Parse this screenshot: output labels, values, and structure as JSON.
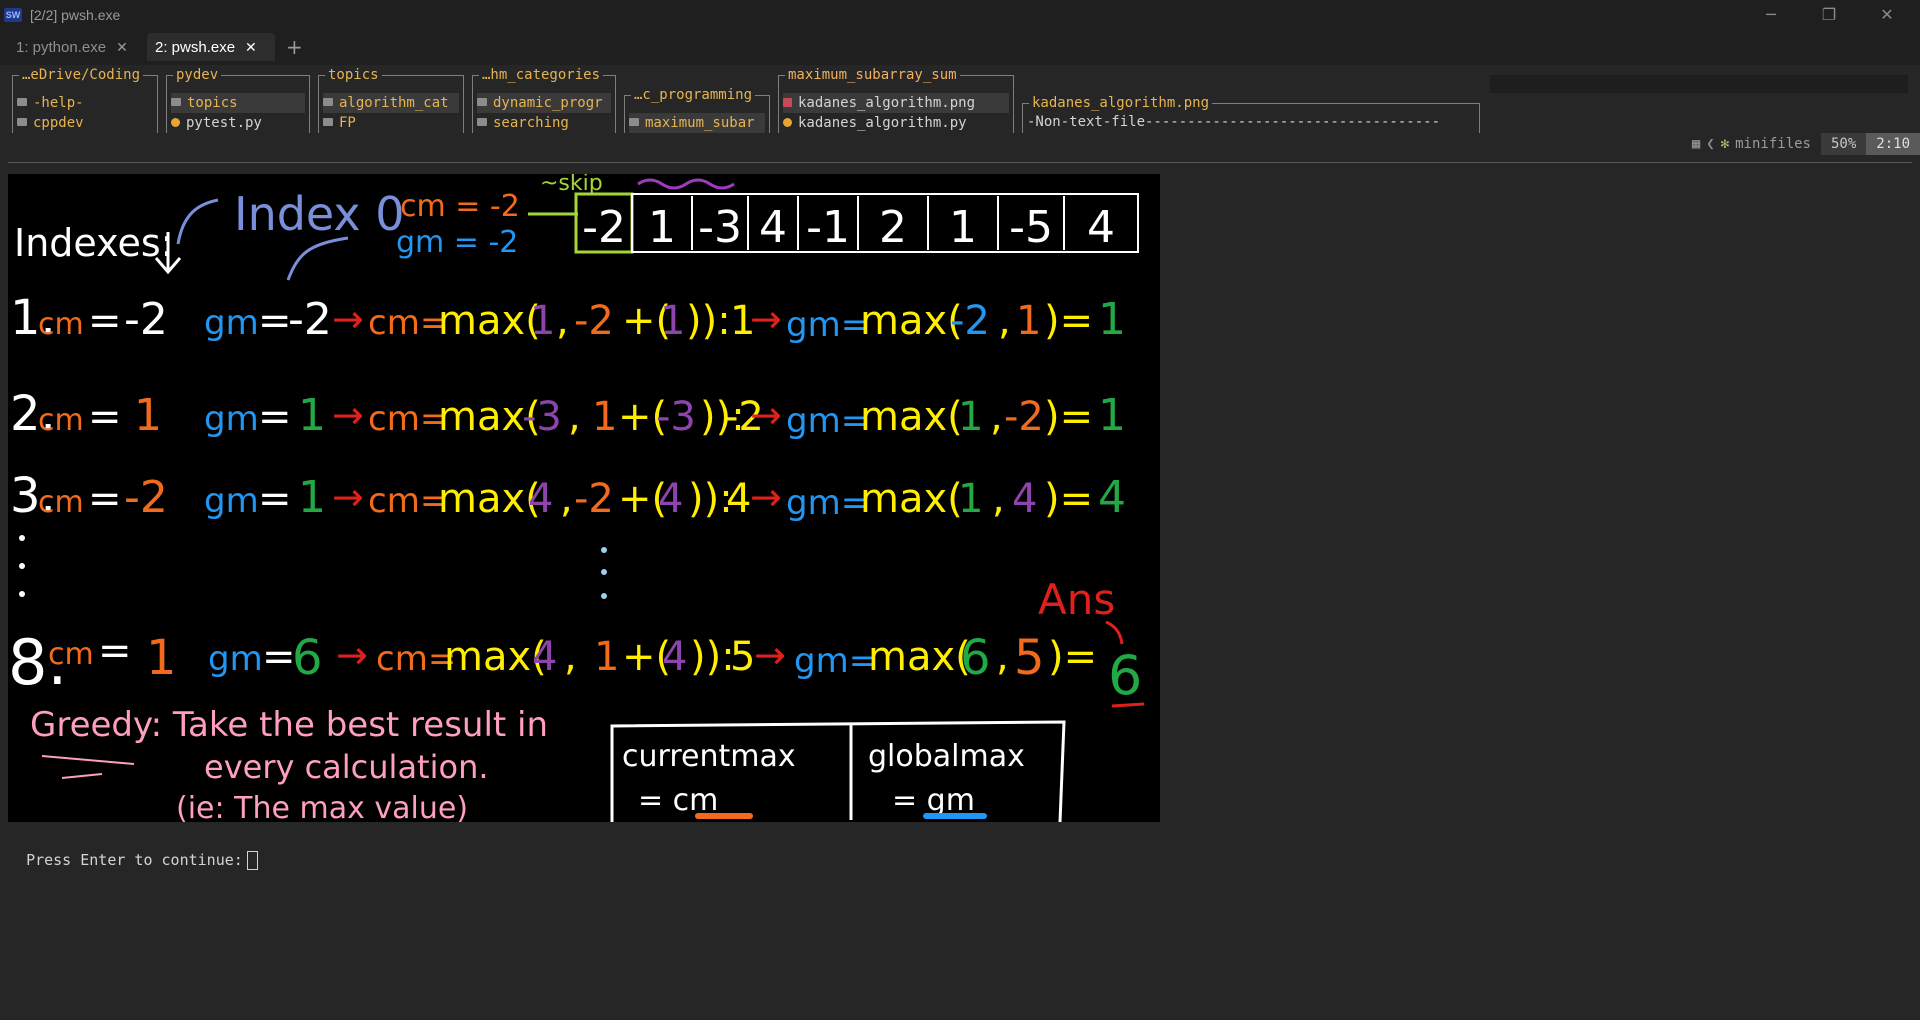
{
  "window": {
    "title": "[2/2] pwsh.exe",
    "icon_label": "SW",
    "controls": {
      "minimize": "─",
      "restore": "❐",
      "close": "✕"
    }
  },
  "tabs": [
    {
      "label": "1: python.exe",
      "close": "✕",
      "active": false
    },
    {
      "label": "2: pwsh.exe",
      "close": "✕",
      "active": true
    }
  ],
  "tab_add": "+",
  "minifiles": {
    "columns": [
      {
        "title": "…eDrive/Coding",
        "items": [
          {
            "name": "-help-",
            "type": "dir"
          },
          {
            "name": "cppdev",
            "type": "dir"
          }
        ]
      },
      {
        "title": "pydev",
        "items": [
          {
            "name": "topics",
            "type": "dir",
            "selected": true
          },
          {
            "name": "pytest.py",
            "type": "py"
          }
        ]
      },
      {
        "title": "topics",
        "items": [
          {
            "name": "algorithm_cat",
            "type": "dir",
            "selected": true
          },
          {
            "name": "FP",
            "type": "dir"
          }
        ]
      },
      {
        "title": "…hm_categories",
        "items": [
          {
            "name": "dynamic_progr",
            "type": "dir",
            "selected": true
          },
          {
            "name": "searching",
            "type": "dir"
          }
        ]
      },
      {
        "title": "…c_programming",
        "items": [
          {
            "name": "maximum_subar",
            "type": "dir",
            "selected": true
          }
        ]
      },
      {
        "title": "maximum_subarray_sum",
        "items": [
          {
            "name": "kadanes_algorithm.png",
            "type": "img",
            "selected": true
          },
          {
            "name": "kadanes_algorithm.py",
            "type": "py"
          }
        ]
      }
    ],
    "preview": {
      "title": "kadanes_algorithm.png",
      "content": "-Non-text-file-----------------------------------"
    }
  },
  "status": {
    "plugin": "minifiles",
    "percent": "50%",
    "position": "2:10"
  },
  "drawing": {
    "top": {
      "index_label": "Index 0",
      "cm": "cm = -2",
      "gm": "gm = -2",
      "indexes": "Indexes:",
      "skip": "~skip",
      "array": [
        "-2",
        "1",
        "-3",
        "4",
        "-1",
        "2",
        "1",
        "-5",
        "4"
      ]
    },
    "rows": [
      {
        "num": "1.",
        "cm_val": "-2",
        "gm_val": "-2",
        "cm_a": "1",
        "cm_b": "-2",
        "cm_c": "1",
        "cm_res": "1",
        "gm_a": "-2",
        "gm_b": "1",
        "gm_res": "1"
      },
      {
        "num": "2.",
        "cm_val": "1",
        "gm_val": "1",
        "cm_a": "-3",
        "cm_b": "1",
        "cm_c": "-3",
        "cm_res": "-2",
        "gm_a": "1",
        "gm_b": "-2",
        "gm_res": "1"
      },
      {
        "num": "3.",
        "cm_val": "-2",
        "gm_val": "1",
        "cm_a": "4",
        "cm_b": "-2",
        "cm_c": "4",
        "cm_res": "4",
        "gm_a": "1",
        "gm_b": "4",
        "gm_res": "4"
      },
      {
        "num": "8.",
        "cm_val": "1",
        "gm_val": "6",
        "cm_a": "4",
        "cm_b": "1",
        "cm_c": "4",
        "cm_res": "5",
        "gm_a": "6",
        "gm_b": "5",
        "gm_res": "6"
      }
    ],
    "ans": "Ans",
    "greedy": {
      "line1": "Greedy: Take the best result in",
      "line2": "every calculation.",
      "line3": "(ie: The max value)"
    },
    "table": {
      "h1": "currentmax",
      "h2": "globalmax",
      "v1": "= cm",
      "v2": "= gm"
    }
  },
  "prompt": "Press Enter to continue:",
  "colors": {
    "orange": "#f26b1d",
    "blue": "#2196f3",
    "yellow": "#ffee00",
    "purple": "#8e44ad",
    "green": "#22a845",
    "red": "#e0201b",
    "pink": "#ff9fbf",
    "white": "#ffffff",
    "lavender": "#7a8fd9"
  }
}
